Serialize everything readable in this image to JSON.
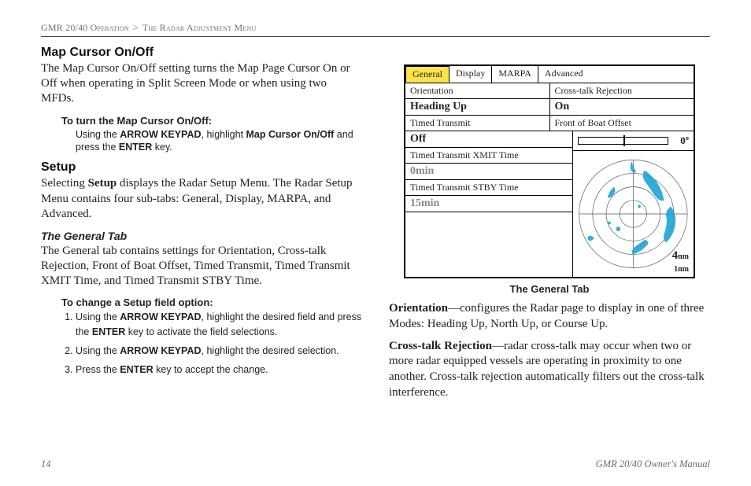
{
  "running_head": {
    "left": "GMR 20/40 Operation",
    "sep": ">",
    "right": "The Radar Adjustment Menu"
  },
  "left_col": {
    "h_mapcursor": "Map Cursor On/Off",
    "p_mapcursor": "The Map Cursor On/Off setting turns the Map Page Cursor On or Off when operating in Split Screen Mode or when using two MFDs.",
    "howto1_title": "To turn the Map Cursor On/Off:",
    "howto1_body_pre": "Using the ",
    "howto1_kw1": "ARROW KEYPAD",
    "howto1_body_mid": ", highlight ",
    "howto1_kw2": "Map Cursor On/Off",
    "howto1_body_mid2": " and press the ",
    "howto1_kw3": "ENTER",
    "howto1_body_end": " key.",
    "h_setup": "Setup",
    "p_setup_pre": "Selecting ",
    "p_setup_bold": "Setup",
    "p_setup_post": " displays the Radar Setup Menu. The Radar Setup Menu contains four sub-tabs: General, Display, MARPA, and Advanced.",
    "h_general": "The General Tab",
    "p_general": "The General tab contains settings for Orientation, Cross-talk Rejection, Front of Boat Offset, Timed Transmit, Timed Transmit XMIT Time, and Timed Transmit STBY Time.",
    "howto2_title": "To change a Setup field option:",
    "steps": {
      "s1_pre": "Using the ",
      "s1_kw1": "ARROW KEYPAD",
      "s1_mid": ", highlight the desired field and press the ",
      "s1_kw2": "ENTER",
      "s1_end": " key to activate the field selections.",
      "s2_pre": "Using the ",
      "s2_kw1": "ARROW KEYPAD",
      "s2_end": ", highlight the desired selection.",
      "s3_pre": "Press the ",
      "s3_kw1": "ENTER",
      "s3_end": " key to accept the change."
    }
  },
  "figure": {
    "tabs": {
      "t1": "General",
      "t2": "Display",
      "t3": "MARPA",
      "t4": "Advanced"
    },
    "labels": {
      "orientation": "Orientation",
      "crosstalk": "Cross-talk Rejection",
      "timed_tx": "Timed Transmit",
      "front_offset": "Front of Boat Offset",
      "xmit_time": "Timed Transmit XMIT Time",
      "stby_time": "Timed Transmit STBY Time"
    },
    "values": {
      "orientation": "Heading Up",
      "crosstalk": "On",
      "timed_tx": "Off",
      "front_offset": "0º",
      "xmit_time": "0min",
      "stby_time": "15min",
      "range_main": "4",
      "range_main_unit": "nm",
      "range_sub": "1nm"
    },
    "caption": "The General Tab"
  },
  "right_col": {
    "def1_term": "Orientation",
    "def1_body": "—configures the Radar page to display in one of three Modes: Heading Up, North Up, or Course Up.",
    "def2_term": "Cross-talk Rejection",
    "def2_body": "—radar cross-talk may occur when two or more radar equipped vessels are operating in proximity to one another. Cross-talk rejection automatically filters out the cross-talk interference."
  },
  "footer": {
    "page": "14",
    "title": "GMR 20/40 Owner's Manual"
  }
}
